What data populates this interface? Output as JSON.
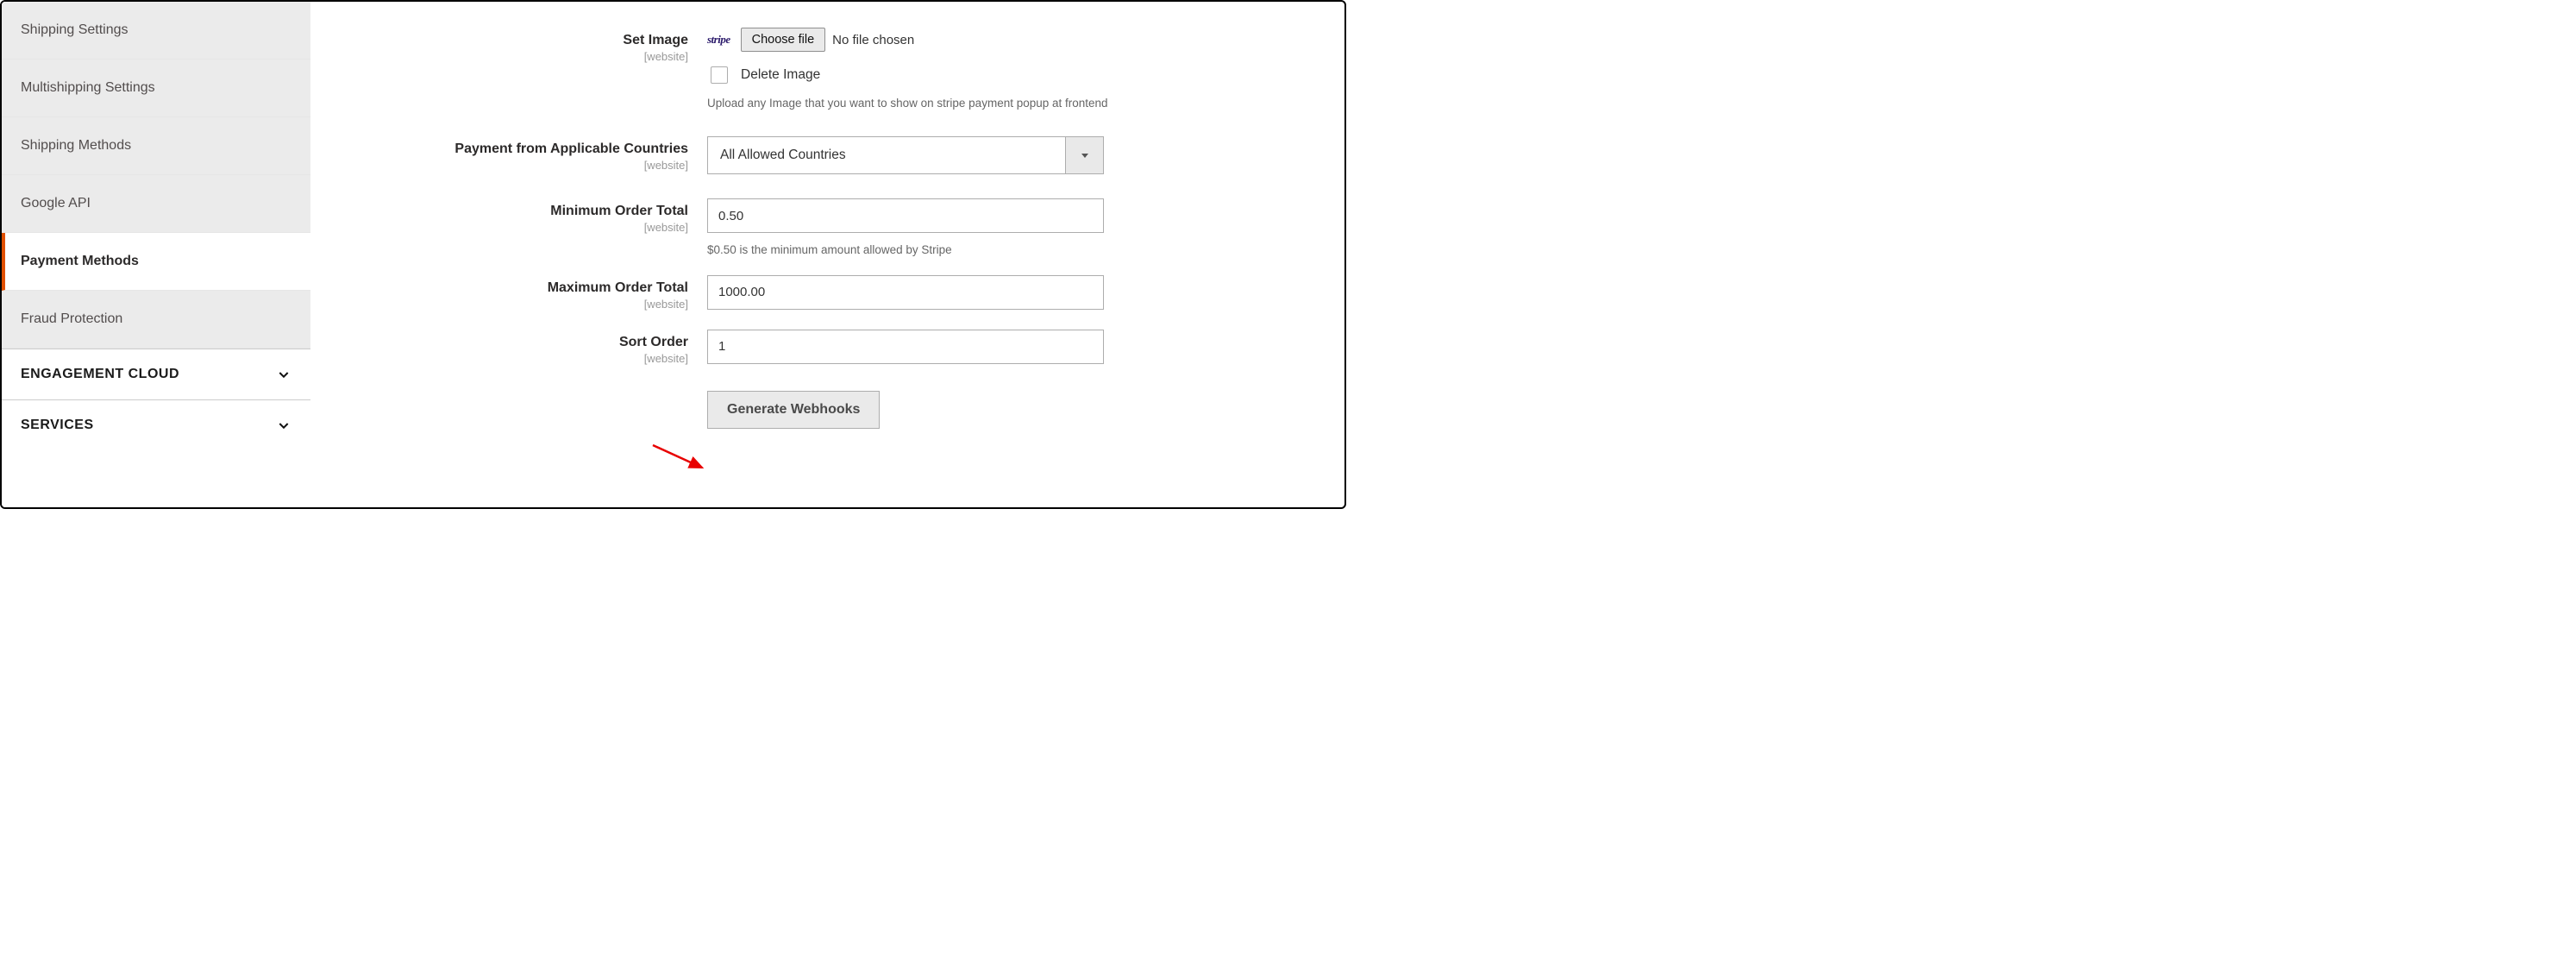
{
  "sidebar": {
    "items": [
      {
        "label": "Shipping Settings"
      },
      {
        "label": "Multishipping Settings"
      },
      {
        "label": "Shipping Methods"
      },
      {
        "label": "Google API"
      },
      {
        "label": "Payment Methods",
        "active": true
      },
      {
        "label": "Fraud Protection"
      }
    ],
    "sections": [
      {
        "label": "ENGAGEMENT CLOUD"
      },
      {
        "label": "SERVICES"
      }
    ]
  },
  "fields": {
    "scope_label": "[website]",
    "set_image": {
      "label": "Set Image",
      "logo_text": "stripe",
      "choose_file_label": "Choose file",
      "no_file_text": "No file chosen",
      "delete_label": "Delete Image",
      "help": "Upload any Image that you want to show on stripe payment popup at frontend"
    },
    "applicable_countries": {
      "label": "Payment from Applicable Countries",
      "value": "All Allowed Countries"
    },
    "min_order": {
      "label": "Minimum Order Total",
      "value": "0.50",
      "help": "$0.50 is the minimum amount allowed by Stripe"
    },
    "max_order": {
      "label": "Maximum Order Total",
      "value": "1000.00"
    },
    "sort_order": {
      "label": "Sort Order",
      "value": "1"
    },
    "generate_webhooks_label": "Generate Webhooks"
  }
}
